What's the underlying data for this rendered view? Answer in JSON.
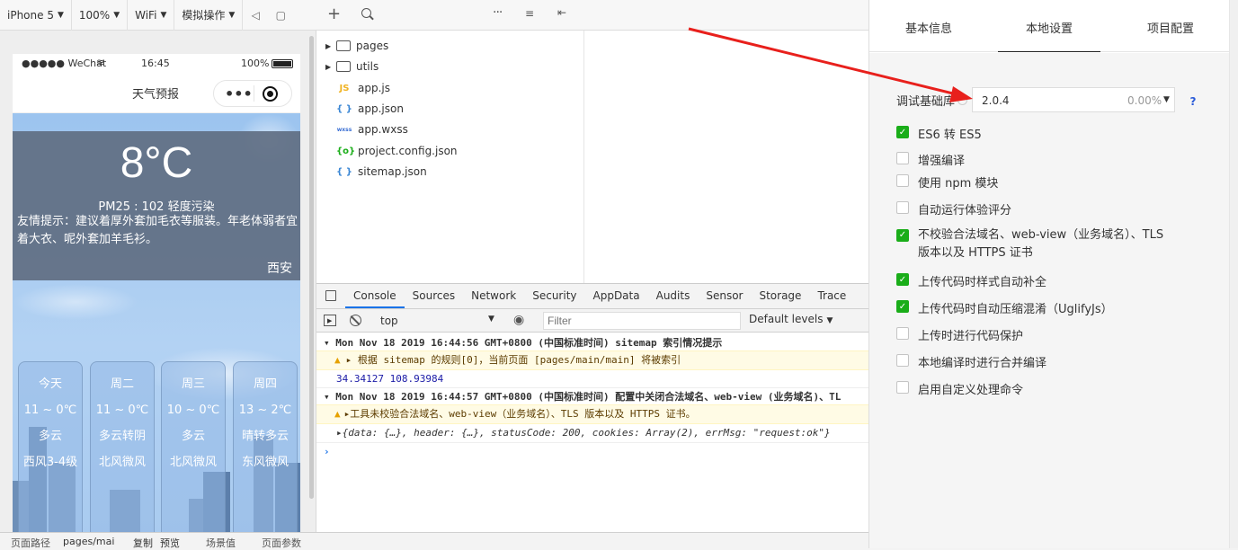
{
  "simulator": {
    "toolbar": {
      "device": "iPhone 5",
      "zoom": "100%",
      "network": "WiFi",
      "simulate": "模拟操作"
    },
    "status_bar": {
      "carrier": "●●●●● WeChat",
      "time": "16:45",
      "battery": "100%"
    },
    "navbar": {
      "title": "天气预报"
    },
    "weather": {
      "temperature": "8°C",
      "aqi": "PM25 : 102 轻度污染",
      "tip": "友情提示：建议着厚外套加毛衣等服装。年老体弱者宜着大衣、呢外套加羊毛衫。",
      "city": "西安"
    },
    "forecast": [
      {
        "day": "今天",
        "temp": "11 ~ 0℃",
        "cond": "多云",
        "wind": "西风3-4级"
      },
      {
        "day": "周二",
        "temp": "11 ~ 0℃",
        "cond": "多云转阴",
        "wind": "北风微风"
      },
      {
        "day": "周三",
        "temp": "10 ~ 0℃",
        "cond": "多云",
        "wind": "北风微风"
      },
      {
        "day": "周四",
        "temp": "13 ~ 2℃",
        "cond": "晴转多云",
        "wind": "东风微风"
      }
    ]
  },
  "filetree": {
    "items": [
      {
        "name": "pages",
        "type": "folder"
      },
      {
        "name": "utils",
        "type": "folder"
      },
      {
        "name": "app.js",
        "type": "js",
        "icon_text": "JS"
      },
      {
        "name": "app.json",
        "type": "json",
        "icon_text": "{ }"
      },
      {
        "name": "app.wxss",
        "type": "wxss",
        "icon_text": "wxss"
      },
      {
        "name": "project.config.json",
        "type": "config",
        "icon_text": "{o}"
      },
      {
        "name": "sitemap.json",
        "type": "json",
        "icon_text": "{ }"
      }
    ]
  },
  "devtools": {
    "tabs": [
      "Console",
      "Sources",
      "Network",
      "Security",
      "AppData",
      "Audits",
      "Sensor",
      "Storage",
      "Trace"
    ],
    "active_tab": "Console",
    "context": "top",
    "filter_placeholder": "Filter",
    "levels": "Default levels",
    "logs": [
      {
        "kind": "group",
        "text": "▾ Mon Nov 18 2019 16:44:56 GMT+0800 (中国标准时间) sitemap 索引情况提示"
      },
      {
        "kind": "warn",
        "text": "▸ 根据 sitemap 的规则[0]，当前页面 [pages/main/main] 将被索引"
      },
      {
        "kind": "plain",
        "text": "34.34127 108.93984"
      },
      {
        "kind": "group",
        "text": "▾ Mon Nov 18 2019 16:44:57 GMT+0800 (中国标准时间) 配置中关闭合法域名、web-view (业务域名)、TL"
      },
      {
        "kind": "warn",
        "text": "▸工具未校验合法域名、web-view（业务域名）、TLS 版本以及 HTTPS 证书。"
      },
      {
        "kind": "obj",
        "text": "▸{data: {…}, header: {…}, statusCode: 200, cookies: Array(2), errMsg: \"request:ok\"}"
      }
    ],
    "prompt": "›"
  },
  "bottom_strip": {
    "path_label": "页面路径",
    "path_value": "pages/mai",
    "copy": "复制",
    "preview": "预览",
    "scene": "场景值",
    "params": "页面参数"
  },
  "settings": {
    "tabs": [
      "基本信息",
      "本地设置",
      "项目配置"
    ],
    "active_tab": "本地设置",
    "base_lib_label": "调试基础库",
    "base_lib_version": "2.0.4",
    "base_lib_percent": "0.00%",
    "help": "?",
    "options": [
      {
        "label": "ES6 转 ES5",
        "checked": true
      },
      {
        "label": "增强编译",
        "checked": false
      },
      {
        "label": "使用 npm 模块",
        "checked": false
      },
      {
        "label": "自动运行体验评分",
        "checked": false
      },
      {
        "label": "不校验合法域名、web-view（业务域名）、TLS 版本以及 HTTPS 证书",
        "checked": true
      },
      {
        "label": "上传代码时样式自动补全",
        "checked": true
      },
      {
        "label": "上传代码时自动压缩混淆（UglifyJs）",
        "checked": true
      },
      {
        "label": "上传时进行代码保护",
        "checked": false
      },
      {
        "label": "本地编译时进行合并编译",
        "checked": false
      },
      {
        "label": "启用自定义处理命令",
        "checked": false
      }
    ]
  },
  "colors": {
    "accent_green": "#1aad19",
    "arrow_red": "#e8201c",
    "devtools_blue": "#1a73e8",
    "warn_bg": "#fffbe5"
  }
}
